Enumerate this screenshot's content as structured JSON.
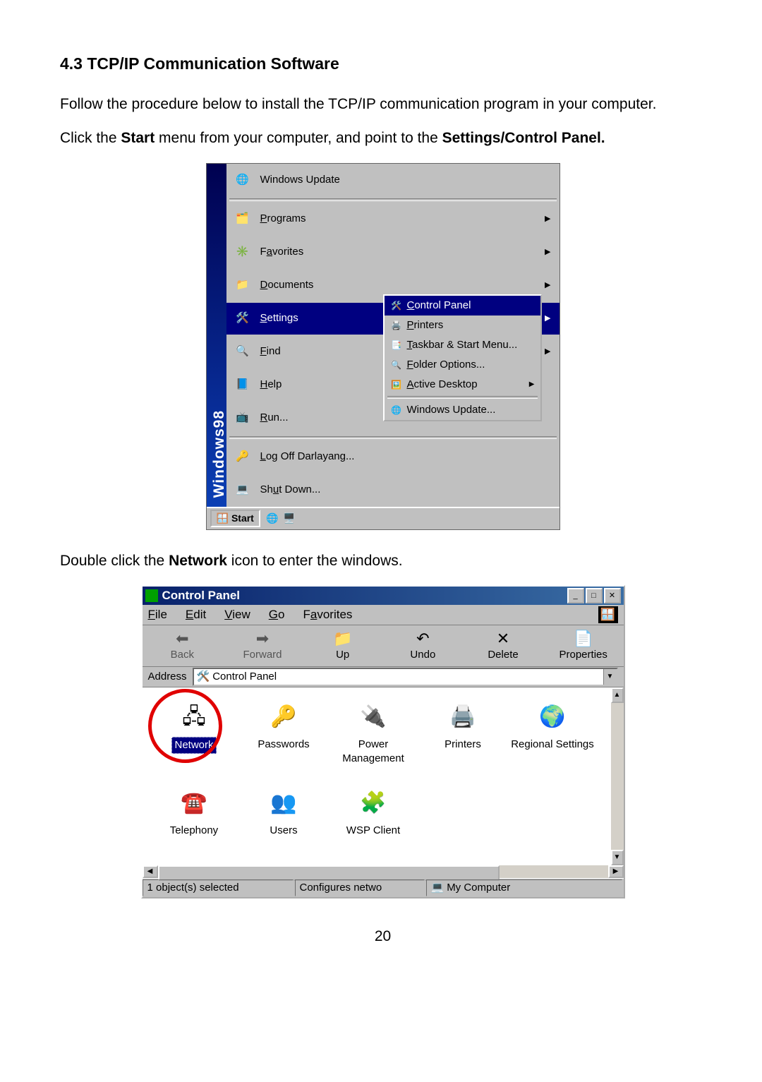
{
  "doc": {
    "heading": "4.3 TCP/IP Communication Software",
    "p1": "Follow the procedure below to install the TCP/IP communication program in your computer.",
    "p2_pre": "Click the ",
    "p2_b1": "Start",
    "p2_mid": " menu from your computer, and point to the ",
    "p2_b2": "Settings/Control Panel.",
    "p3_pre": "Double click the ",
    "p3_b": "Network",
    "p3_post": " icon to enter the windows.",
    "pagenum": "20"
  },
  "startmenu": {
    "sidelabel": "Windows98",
    "items": {
      "winupdate": "Windows Update",
      "programs": "Programs",
      "favorites": "Favorites",
      "documents": "Documents",
      "settings": "Settings",
      "find": "Find",
      "help": "Help",
      "run": "Run...",
      "logoff": "Log Off Darlayang...",
      "shutdown": "Shut Down..."
    },
    "submenu": {
      "controlpanel": "Control Panel",
      "printers": "Printers",
      "taskbar": "Taskbar & Start Menu...",
      "folderopt": "Folder Options...",
      "activedesk": "Active Desktop",
      "winupdate": "Windows Update..."
    },
    "taskbar": {
      "start": "Start"
    }
  },
  "cp": {
    "title": "Control Panel",
    "menu": {
      "file": "File",
      "edit": "Edit",
      "view": "View",
      "go": "Go",
      "fav": "Favorites"
    },
    "toolbar": {
      "back": "Back",
      "forward": "Forward",
      "up": "Up",
      "undo": "Undo",
      "delete": "Delete",
      "prop": "Properties"
    },
    "address_label": "Address",
    "address_value": "Control Panel",
    "icons": {
      "network": "Network",
      "passwords": "Passwords",
      "power": "Power Management",
      "printers": "Printers",
      "regional": "Regional Settings",
      "telephony": "Telephony",
      "users": "Users",
      "wsp": "WSP Client"
    },
    "status": {
      "sel": "1 object(s) selected",
      "desc": "Configures netwo",
      "loc": "My Computer"
    }
  }
}
